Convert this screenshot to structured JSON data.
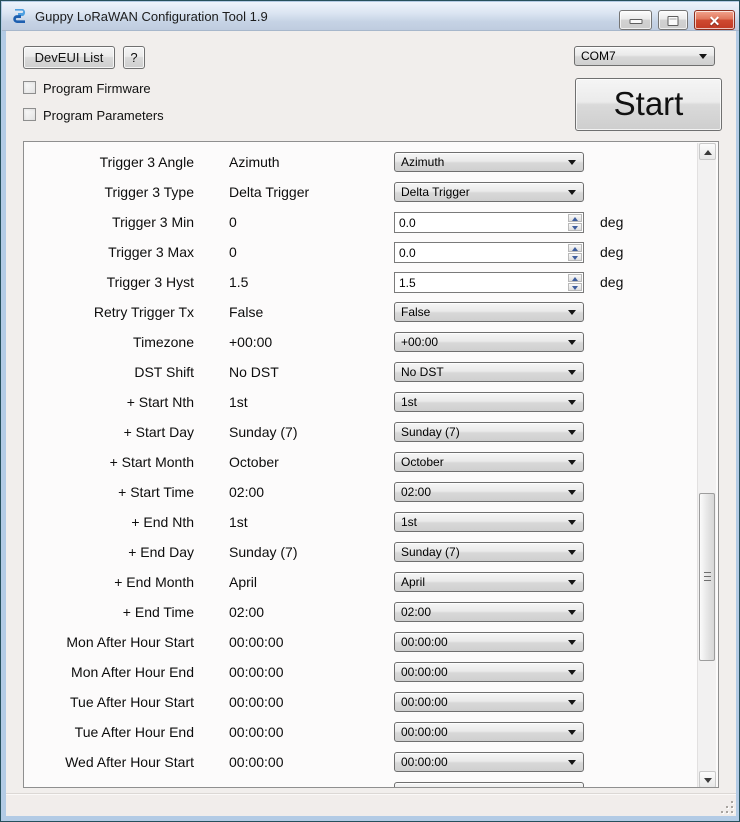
{
  "window": {
    "title": "Guppy LoRaWAN Configuration Tool 1.9"
  },
  "toolbar": {
    "deveui_button": "DevEUI List",
    "help_button": "?",
    "com_port_selected": "COM7",
    "start_button": "Start",
    "checkboxes": [
      {
        "label": "Program Firmware",
        "checked": false
      },
      {
        "label": "Program Parameters",
        "checked": false
      }
    ]
  },
  "settings": {
    "rows": [
      {
        "label": "Trigger 3 Angle",
        "value": "Azimuth",
        "control": "dropdown",
        "control_value": "Azimuth"
      },
      {
        "label": "Trigger 3 Type",
        "value": "Delta Trigger",
        "control": "dropdown",
        "control_value": "Delta Trigger"
      },
      {
        "label": "Trigger 3 Min",
        "value": "0",
        "control": "spinner",
        "control_value": "0.0",
        "unit": "deg"
      },
      {
        "label": "Trigger 3 Max",
        "value": "0",
        "control": "spinner",
        "control_value": "0.0",
        "unit": "deg"
      },
      {
        "label": "Trigger 3 Hyst",
        "value": "1.5",
        "control": "spinner",
        "control_value": "1.5",
        "unit": "deg"
      },
      {
        "label": "Retry Trigger Tx",
        "value": "False",
        "control": "dropdown",
        "control_value": "False"
      },
      {
        "label": "Timezone",
        "value": "+00:00",
        "control": "dropdown",
        "control_value": "+00:00"
      },
      {
        "label": "DST Shift",
        "value": "No DST",
        "control": "dropdown",
        "control_value": "No DST"
      },
      {
        "label": "+ Start Nth",
        "value": "1st",
        "control": "dropdown",
        "control_value": "1st"
      },
      {
        "label": "+ Start Day",
        "value": "Sunday (7)",
        "control": "dropdown",
        "control_value": "Sunday (7)"
      },
      {
        "label": "+ Start Month",
        "value": "October",
        "control": "dropdown",
        "control_value": "October"
      },
      {
        "label": "+ Start Time",
        "value": "02:00",
        "control": "dropdown",
        "control_value": "02:00"
      },
      {
        "label": "+ End Nth",
        "value": "1st",
        "control": "dropdown",
        "control_value": "1st"
      },
      {
        "label": "+ End Day",
        "value": "Sunday (7)",
        "control": "dropdown",
        "control_value": "Sunday (7)"
      },
      {
        "label": "+ End Month",
        "value": "April",
        "control": "dropdown",
        "control_value": "April"
      },
      {
        "label": "+ End Time",
        "value": "02:00",
        "control": "dropdown",
        "control_value": "02:00"
      },
      {
        "label": "Mon After Hour Start",
        "value": "00:00:00",
        "control": "dropdown",
        "control_value": "00:00:00"
      },
      {
        "label": "Mon After Hour End",
        "value": "00:00:00",
        "control": "dropdown",
        "control_value": "00:00:00"
      },
      {
        "label": "Tue After Hour Start",
        "value": "00:00:00",
        "control": "dropdown",
        "control_value": "00:00:00"
      },
      {
        "label": "Tue After Hour End",
        "value": "00:00:00",
        "control": "dropdown",
        "control_value": "00:00:00"
      },
      {
        "label": "Wed After Hour Start",
        "value": "00:00:00",
        "control": "dropdown",
        "control_value": "00:00:00"
      }
    ]
  },
  "colors": {
    "frame_blue": "#b3cbe5",
    "frame_outline": "#26505c",
    "close_button_red": "#c23a24",
    "client_bg": "#f1eeec",
    "panel_bg": "#fcfbfb"
  }
}
